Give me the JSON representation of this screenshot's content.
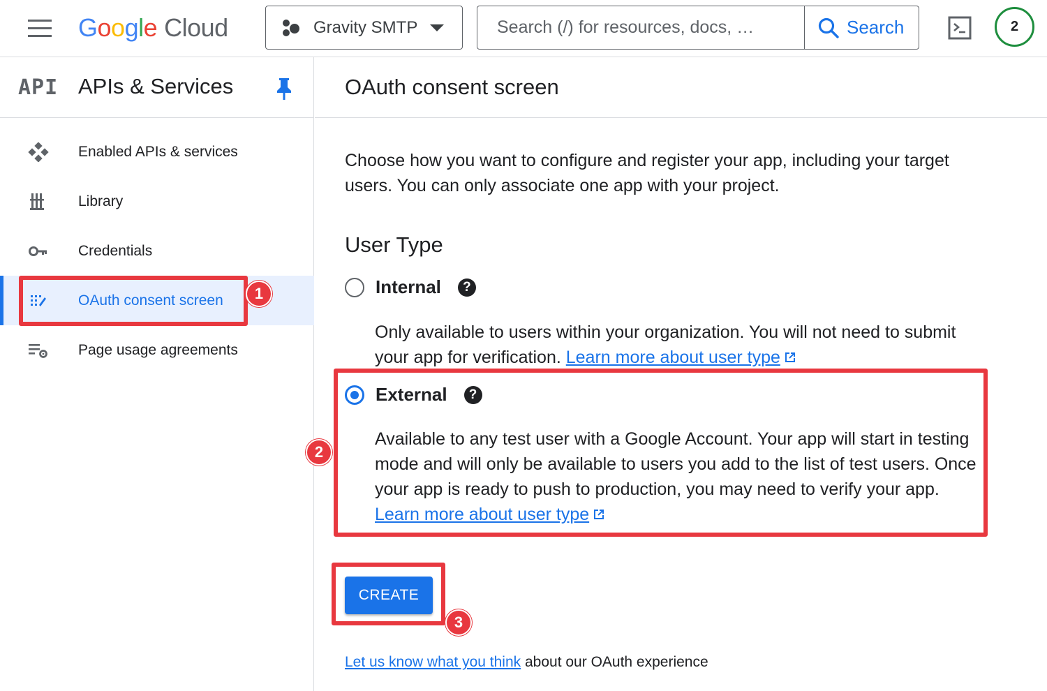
{
  "topbar": {
    "logo_letters": [
      "G",
      "o",
      "o",
      "g",
      "l",
      "e"
    ],
    "logo_suffix": "Cloud",
    "project_name": "Gravity SMTP",
    "search_placeholder": "Search (/) for resources, docs, …",
    "search_button": "Search",
    "notification_count": "2"
  },
  "sidebar": {
    "api_logo": "API",
    "title": "APIs & Services",
    "items": [
      {
        "label": "Enabled APIs & services",
        "icon": "enabled-apis-icon"
      },
      {
        "label": "Library",
        "icon": "library-icon"
      },
      {
        "label": "Credentials",
        "icon": "key-icon"
      },
      {
        "label": "OAuth consent screen",
        "icon": "oauth-icon",
        "active": true
      },
      {
        "label": "Page usage agreements",
        "icon": "settings-list-icon"
      }
    ]
  },
  "main": {
    "title": "OAuth consent screen",
    "intro": "Choose how you want to configure and register your app, including your target users. You can only associate one app with your project.",
    "user_type_heading": "User Type",
    "internal": {
      "label": "Internal",
      "description": "Only available to users within your organization. You will not need to submit your app for verification.",
      "link": "Learn more about user type"
    },
    "external": {
      "label": "External",
      "selected": true,
      "description": "Available to any test user with a Google Account. Your app will start in testing mode and will only be available to users you add to the list of test users. Once your app is ready to push to production, you may need to verify your app.",
      "link": "Learn more about user type"
    },
    "create_button": "CREATE",
    "feedback_link": "Let us know what you think",
    "feedback_text": " about our OAuth experience"
  },
  "annotations": [
    "1",
    "2",
    "3"
  ],
  "colors": {
    "accent": "#1a73e8",
    "highlight": "#e8383f",
    "active_bg": "#e8f0fe",
    "badge_ring": "#1e8e3e"
  }
}
